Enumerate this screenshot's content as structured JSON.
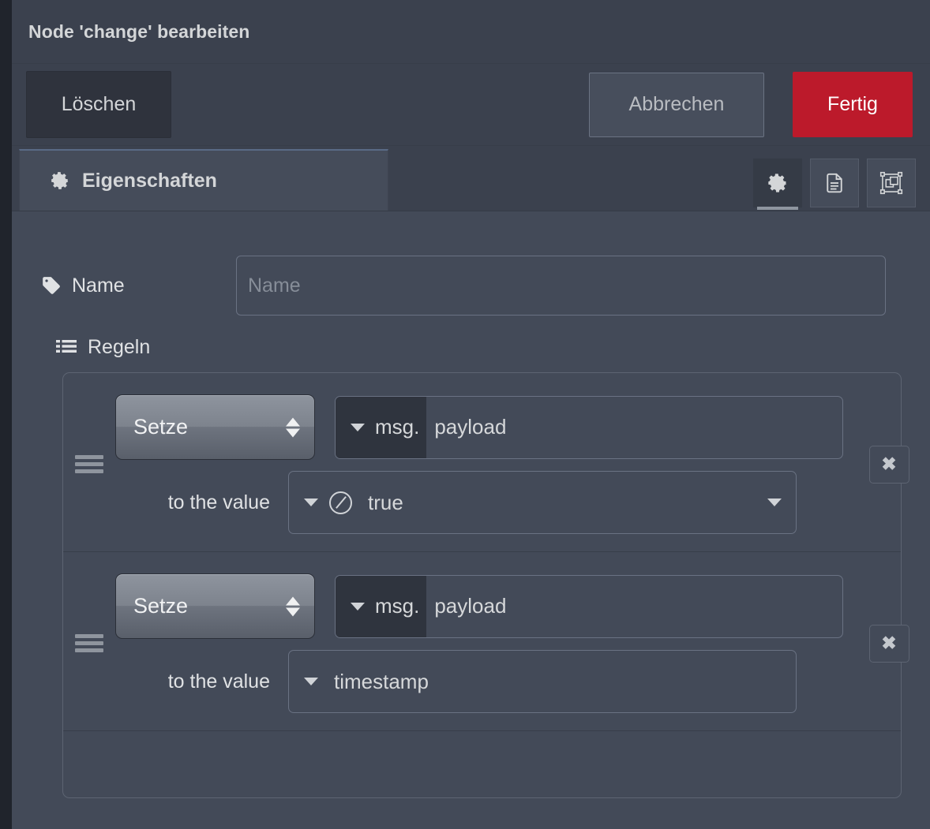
{
  "dialog": {
    "title": "Node 'change' bearbeiten",
    "toolbar": {
      "delete_label": "Löschen",
      "cancel_label": "Abbrechen",
      "done_label": "Fertig",
      "done_color": "#bc1a2b"
    },
    "tabs": [
      {
        "label": "Eigenschaften",
        "icon": "gear-icon",
        "active": true
      }
    ],
    "tab_icon_buttons": [
      {
        "name": "properties-icon",
        "icon": "gear-icon",
        "active": true
      },
      {
        "name": "description-icon",
        "icon": "document-icon",
        "active": false
      },
      {
        "name": "appearance-icon",
        "icon": "appearance-icon",
        "active": false
      }
    ],
    "form": {
      "name_label": "Name",
      "name_icon": "tag-icon",
      "name_value": "",
      "name_placeholder": "Name",
      "rules_label": "Regeln",
      "rules_icon": "list-icon"
    },
    "rules": [
      {
        "action": "Setze",
        "property_prefix": "msg.",
        "property_value": "payload",
        "value_label": "to the value",
        "value_type_icon": "boolean-icon",
        "value_text": "true",
        "has_value_type_icon": true,
        "has_right_caret": true,
        "delete_label": "✖"
      },
      {
        "action": "Setze",
        "property_prefix": "msg.",
        "property_value": "payload",
        "value_label": "to the value",
        "value_type_icon": "",
        "value_text": "timestamp",
        "has_value_type_icon": false,
        "has_right_caret": false,
        "delete_label": "✖"
      }
    ]
  }
}
